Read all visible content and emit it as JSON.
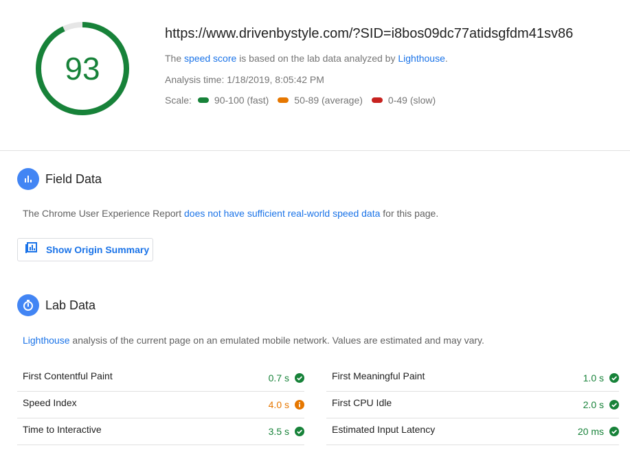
{
  "score": {
    "value": "93",
    "fraction": 0.93,
    "color": "#178239"
  },
  "url": "https://www.drivenbystyle.com/?SID=i8bos09dc77atidsgfdm41sv86",
  "summary": {
    "prefix": "The ",
    "speed_score_link": "speed score",
    "middle": " is based on the lab data analyzed by ",
    "lighthouse_link": "Lighthouse",
    "suffix": "."
  },
  "analysis_time": "Analysis time: 1/18/2019, 8:05:42 PM",
  "scale": {
    "label": "Scale:",
    "items": [
      {
        "label": "90-100 (fast)",
        "color": "#178239"
      },
      {
        "label": "50-89 (average)",
        "color": "#e67700"
      },
      {
        "label": "0-49 (slow)",
        "color": "#c7221f"
      }
    ]
  },
  "field_data": {
    "title": "Field Data",
    "icon": "bar-chart-icon",
    "text_prefix": "The Chrome User Experience Report ",
    "text_link": "does not have sufficient real-world speed data",
    "text_suffix": " for this page.",
    "button_label": "Show Origin Summary",
    "button_icon": "library-chart-icon"
  },
  "lab_data": {
    "title": "Lab Data",
    "icon": "stopwatch-icon",
    "text_link": "Lighthouse",
    "text_suffix": " analysis of the current page on an emulated mobile network. Values are estimated and may vary.",
    "metrics_left": [
      {
        "label": "First Contentful Paint",
        "value": "0.7 s",
        "status": "pass"
      },
      {
        "label": "Speed Index",
        "value": "4.0 s",
        "status": "average"
      },
      {
        "label": "Time to Interactive",
        "value": "3.5 s",
        "status": "pass"
      }
    ],
    "metrics_right": [
      {
        "label": "First Meaningful Paint",
        "value": "1.0 s",
        "status": "pass"
      },
      {
        "label": "First CPU Idle",
        "value": "2.0 s",
        "status": "pass"
      },
      {
        "label": "Estimated Input Latency",
        "value": "20 ms",
        "status": "pass"
      }
    ]
  }
}
